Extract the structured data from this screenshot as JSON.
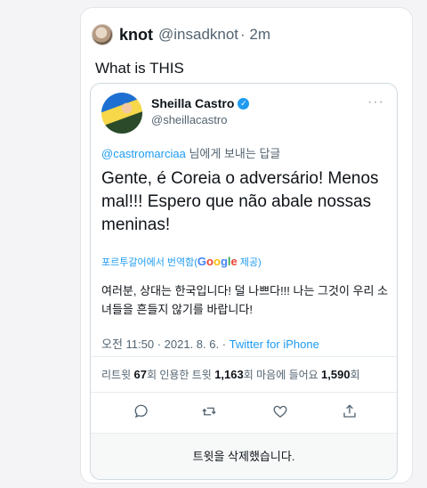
{
  "tweet": {
    "author_name": "knot",
    "handle": "@insadknot",
    "time": "· 2m",
    "text": "What is THIS"
  },
  "quoted": {
    "name": "Sheilla Castro",
    "handle": "@sheillacastro",
    "reply_mention": "@castromarciaa",
    "reply_suffix": " 님에게 보내는 답글",
    "text": "Gente, é Coreia o adversário! Menos mal!!! Espero que não abale nossas meninas!",
    "translate_prefix": "포르투갈어에서 번역함(",
    "translate_suffix": " 제공)",
    "google_letters": [
      "G",
      "o",
      "o",
      "g",
      "l",
      "e"
    ],
    "translation": "여러분, 상대는 한국입니다! 덜 나쁘다!!! 나는 그것이 우리 소녀들을 흔들지 않기를 바랍니다!",
    "timestamp": "오전 11:50 · 2021. 8. 6. · ",
    "client": "Twitter for iPhone",
    "stats": {
      "retweets_label": "리트윗 ",
      "retweets": "67",
      "retweets_unit": "회  ",
      "quotes_label": "인용한 트윗 ",
      "quotes": "1,163",
      "quotes_unit": "회  ",
      "likes_label": "마음에 들어요 ",
      "likes": "1,590",
      "likes_unit": "회"
    },
    "deleted_notice": "트윗을 삭제했습니다."
  },
  "colors": {
    "link": "#1d9bf0",
    "muted": "#536471",
    "page_bg": "#f4f4f6"
  }
}
